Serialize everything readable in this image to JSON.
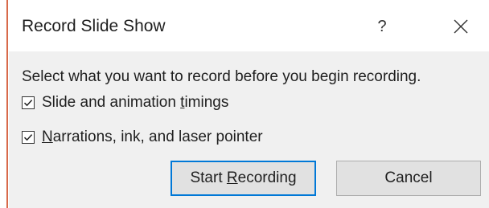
{
  "dialog": {
    "title": "Record Slide Show",
    "help_label": "?",
    "close_icon": "close-icon",
    "prompt": "Select what you want to record before you begin recording.",
    "options": [
      {
        "label_before": "Slide and animation ",
        "label_mnemonic": "t",
        "label_after": "imings",
        "checked": true
      },
      {
        "label_before": "",
        "label_mnemonic": "N",
        "label_after": "arrations, ink, and laser pointer",
        "checked": true
      }
    ],
    "buttons": {
      "start": {
        "label_before": "Start ",
        "label_mnemonic": "R",
        "label_after": "ecording"
      },
      "cancel": {
        "label": "Cancel"
      }
    },
    "colors": {
      "accent_focus": "#0078d7",
      "panel_bg": "#f0f0f0",
      "button_bg": "#e1e1e1",
      "window_edge": "#d86a4a"
    }
  }
}
